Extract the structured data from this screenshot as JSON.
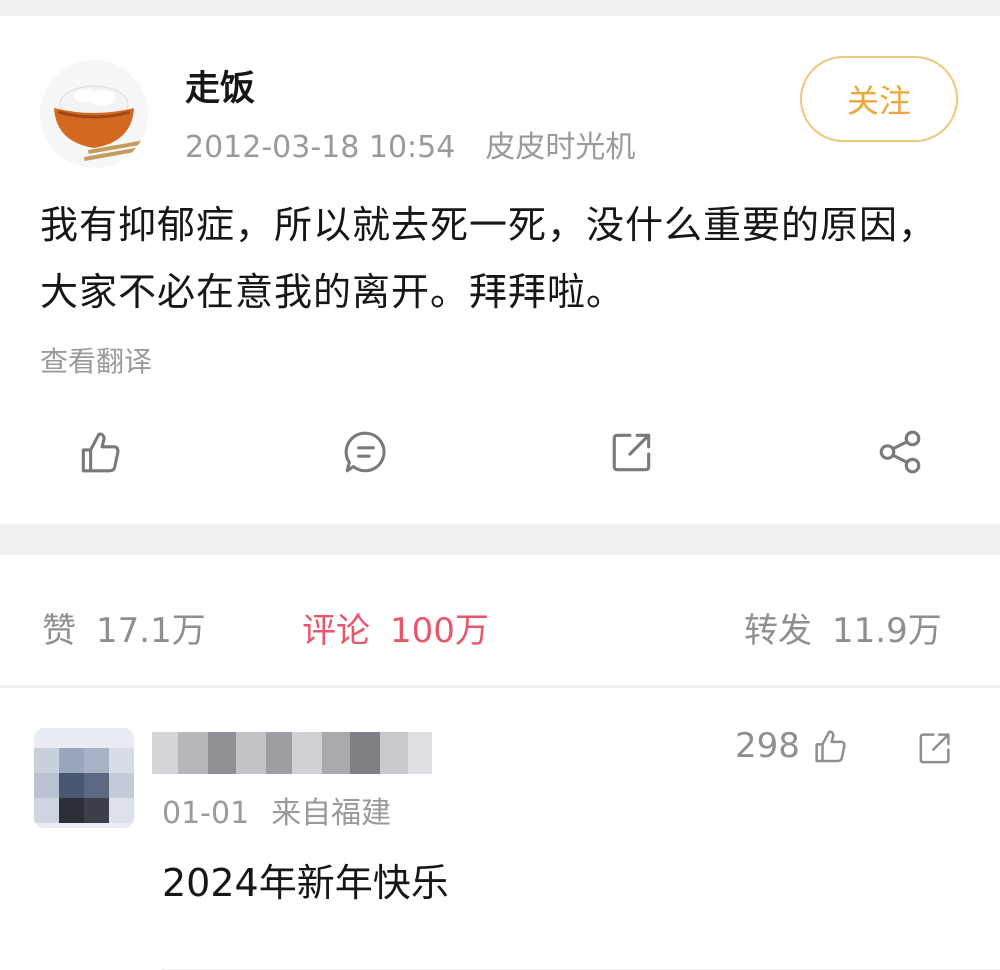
{
  "post": {
    "username": "走饭",
    "date": "2012-03-18 10:54",
    "source": "皮皮时光机",
    "follow_label": "关注",
    "text": "我有抑郁症，所以就去死一死，没什么重要的原因，大家不必在意我的离开。拜拜啦。",
    "translate_label": "查看翻译",
    "actions": [
      "like-icon",
      "comment-icon",
      "repost-icon",
      "share-icon"
    ]
  },
  "stats": {
    "likes_label": "赞",
    "likes_count": "17.1万",
    "comments_label": "评论",
    "comments_count": "100万",
    "reposts_label": "转发",
    "reposts_count": "11.9万",
    "active_color": "#e8566b"
  },
  "comment": {
    "date": "01-01",
    "location": "来自福建",
    "text": "2024年新年快乐",
    "likes": "298"
  },
  "colors": {
    "follow_accent": "#f0a43a",
    "muted_text": "#9a9a9a"
  }
}
